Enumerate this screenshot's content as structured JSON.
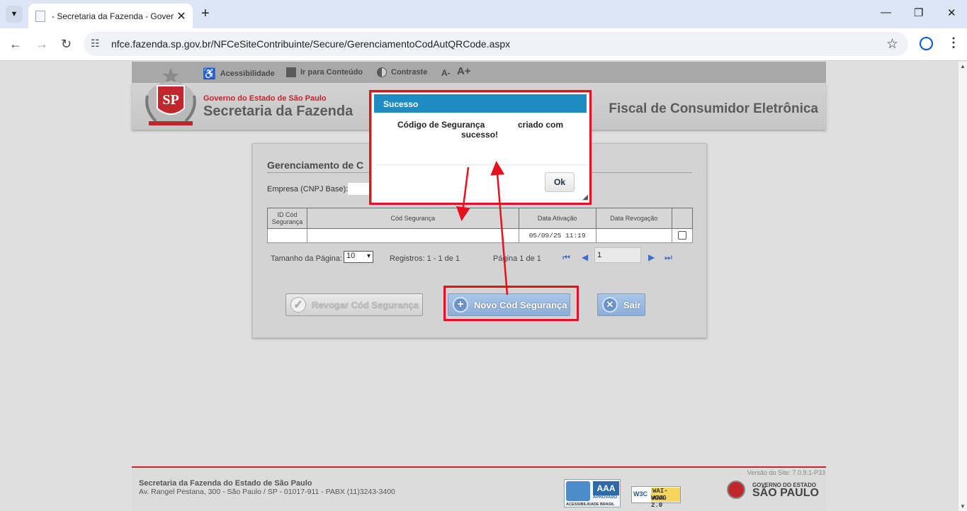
{
  "browser": {
    "tab_title": "- Secretaria da Fazenda - Gover",
    "url": "nfce.fazenda.sp.gov.br/NFCeSiteContribuinte/Secure/GerenciamentoCodAutQRCode.aspx"
  },
  "accessibility": {
    "acessibilidade": "Acessibilidade",
    "ir_conteudo": "Ir para Conteúdo",
    "contraste": "Contraste",
    "font_minus": "A-",
    "font_plus": "A+"
  },
  "header": {
    "gov": "Governo do Estado de São Paulo",
    "secretaria": "Secretaria da Fazenda",
    "nfce": "Fiscal de Consumidor Eletrônica"
  },
  "panel": {
    "title": "Gerenciamento de C",
    "empresa_label": "Empresa (CNPJ Base):"
  },
  "grid": {
    "headers": [
      "ID Cód Segurança",
      "Cód Segurança",
      "Data Ativação",
      "Data Revogação"
    ],
    "rows": [
      {
        "id": "",
        "cod": "",
        "ativacao": "05/09/25 11:19",
        "revogacao": ""
      }
    ]
  },
  "pager": {
    "page_size_label": "Tamanho da Página:",
    "page_size": "10",
    "records": "Registros: 1 - 1 de 1",
    "page_info": "Página 1 de 1",
    "current_page": "1"
  },
  "buttons": {
    "revogar": "Revogar Cód Segurança",
    "novo": "Novo Cód Segurança",
    "sair": "Sair"
  },
  "modal": {
    "title": "Sucesso",
    "msg_part1": "Código de Segurança",
    "msg_part2": "criado com",
    "msg_part3": "sucesso!",
    "ok": "Ok"
  },
  "footer": {
    "name": "Secretaria da Fazenda do Estado de São Paulo",
    "address": "Av. Rangel Pestana, 300 - São Paulo / SP - 01017-911 - PABX (11)3243-3400",
    "version": "Versão do Site: 7.0.9.1-P33",
    "badge_aaa": "AAA",
    "badge_aprovado": "APROVADO",
    "badge_acess": "ACESSIBILIDADE BRASIL",
    "badge_w3c": "W3C",
    "badge_wai": "WAI-AAA",
    "badge_wcag": "WCAG 2.0",
    "gov_small": "GOVERNO DO ESTADO",
    "gov_big": "SÃO PAULO"
  },
  "colors": {
    "annotation_red": "#e8101c",
    "modal_header": "#1e8bc3",
    "button_blue": "#8aaed9"
  },
  "icons": [
    "chevron-down-icon",
    "close-icon",
    "plus-icon",
    "minimize-icon",
    "restore-icon",
    "back-icon",
    "forward-icon",
    "reload-icon",
    "site-info-icon",
    "star-icon",
    "profile-icon",
    "menu-icon",
    "accessibility-icon",
    "document-icon",
    "contrast-icon",
    "check-icon",
    "x-icon",
    "first-page-icon",
    "prev-page-icon",
    "next-page-icon",
    "last-page-icon",
    "resize-icon"
  ]
}
